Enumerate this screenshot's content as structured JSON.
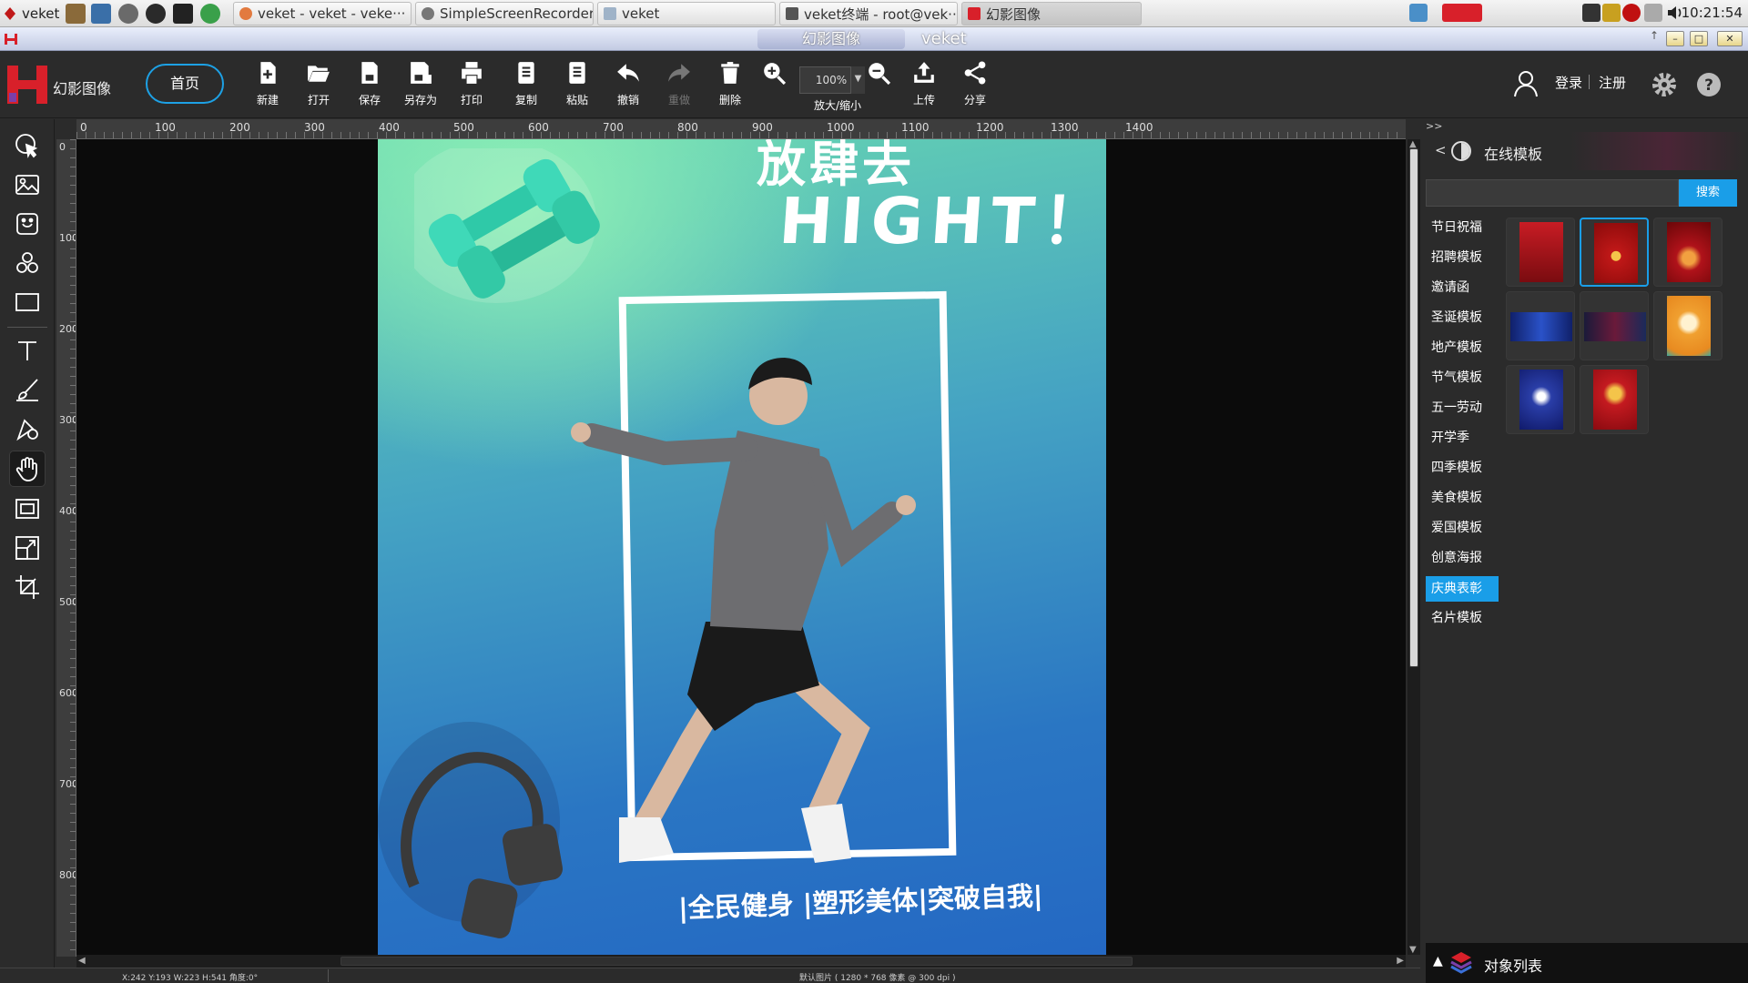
{
  "taskbar": {
    "start_label": "veket",
    "tasks": [
      {
        "label": "veket - veket - veke···"
      },
      {
        "label": "SimpleScreenRecorder"
      },
      {
        "label": "veket"
      },
      {
        "label": "veket终端 - root@vek···"
      },
      {
        "label": "幻影图像"
      }
    ],
    "clock": "10:21:54"
  },
  "window": {
    "title_pill": "幻影图像",
    "title": "veket",
    "buttons": {
      "minimize": "–",
      "maximize": "□",
      "close": "✕"
    }
  },
  "app": {
    "name": "幻影图像",
    "home_label": "首页",
    "tools": {
      "new": "新建",
      "open": "打开",
      "save": "保存",
      "save_as": "另存为",
      "print": "打印",
      "copy": "复制",
      "paste": "粘贴",
      "undo": "撤销",
      "redo": "重做",
      "delete": "删除",
      "zoom_label": "放大/缩小",
      "upload": "上传",
      "share": "分享"
    },
    "zoom_value": "100%",
    "login": "登录",
    "register": "注册"
  },
  "ruler": {
    "top": [
      "0",
      "100",
      "200",
      "300",
      "400",
      "500",
      "600",
      "700",
      "800",
      "900",
      "1000",
      "1100",
      "1200",
      "1300",
      "1400"
    ],
    "left": [
      "0",
      "100",
      "200",
      "300",
      "400",
      "500",
      "600",
      "700",
      "800"
    ]
  },
  "poster": {
    "title_line1": "放肆去",
    "title_line2": "HIGHT！",
    "slogan": "|全民健身 |塑形美体|突破自我|"
  },
  "status": {
    "left": "X:242  Y:193  W:223  H:541  角度:0°",
    "middle": "默认图片 ( 1280 * 768 像素 @ 300 dpi )"
  },
  "right_panel": {
    "toggle": ">>",
    "back": "<",
    "title": "在线模板",
    "search_placeholder": "",
    "search_button": "搜索",
    "categories": [
      "节日祝福",
      "招聘模板",
      "邀请函",
      "圣诞模板",
      "地产模板",
      "节气模板",
      "五一劳动",
      "开学季",
      "四季模板",
      "美食模板",
      "爱国模板",
      "创意海报",
      "庆典表彰",
      "名片模板"
    ],
    "selected_category": "庆典表彰",
    "object_list": "对象列表"
  },
  "colors": {
    "accent": "#1a9ee8",
    "toolbar_bg": "#2b2b2b",
    "canvas_bg": "#0b0b0b"
  }
}
